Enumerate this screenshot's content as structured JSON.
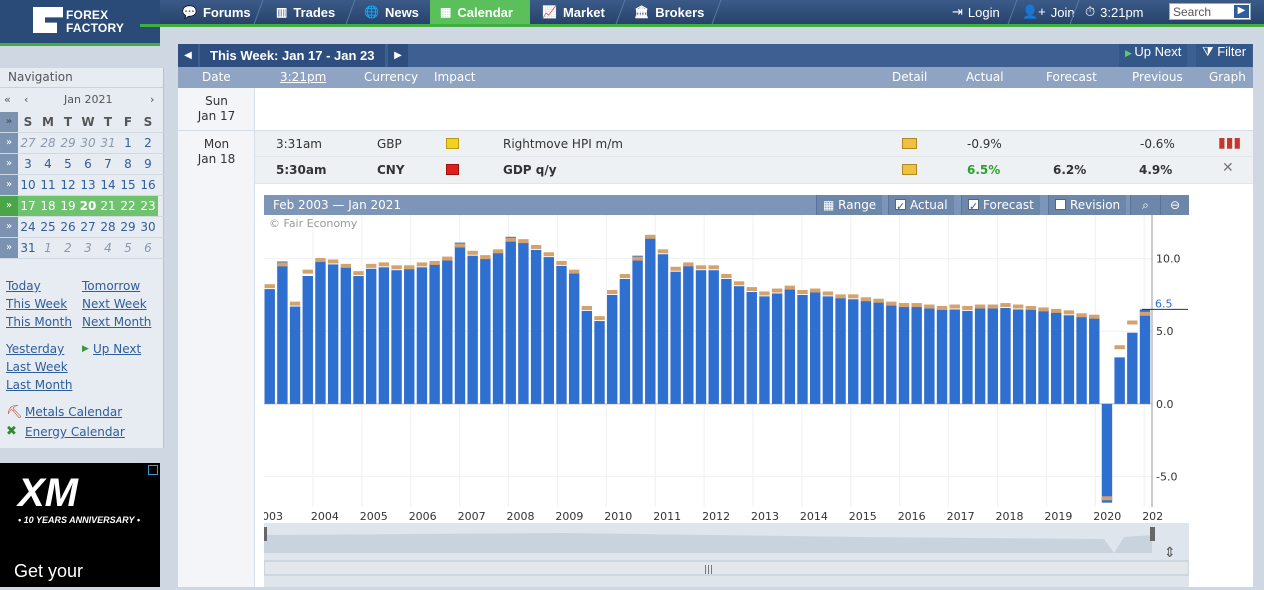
{
  "header": {
    "logo_line1": "FOREX",
    "logo_line2": "FACTORY",
    "nav": [
      {
        "label": "Forums",
        "icon": "chat-icon"
      },
      {
        "label": "Trades",
        "icon": "bars-icon"
      },
      {
        "label": "News",
        "icon": "globe-icon"
      },
      {
        "label": "Calendar",
        "icon": "calendar-icon"
      },
      {
        "label": "Market",
        "icon": "market-chart-icon"
      },
      {
        "label": "Brokers",
        "icon": "brokers-icon"
      }
    ],
    "login": "Login",
    "join": "Join",
    "time": "3:21pm",
    "search_placeholder": "Search"
  },
  "sidebar": {
    "title": "Navigation",
    "month": "Jan 2021",
    "weekdays": [
      "S",
      "M",
      "T",
      "W",
      "T",
      "F",
      "S"
    ],
    "weeks": [
      [
        "27",
        "28",
        "29",
        "30",
        "31",
        "1",
        "2"
      ],
      [
        "3",
        "4",
        "5",
        "6",
        "7",
        "8",
        "9"
      ],
      [
        "10",
        "11",
        "12",
        "13",
        "14",
        "15",
        "16"
      ],
      [
        "17",
        "18",
        "19",
        "20",
        "21",
        "22",
        "23"
      ],
      [
        "24",
        "25",
        "26",
        "27",
        "28",
        "29",
        "30"
      ],
      [
        "31",
        "1",
        "2",
        "3",
        "4",
        "5",
        "6"
      ]
    ],
    "links": {
      "today": "Today",
      "tomorrow": "Tomorrow",
      "this_week": "This Week",
      "next_week": "Next Week",
      "this_month": "This Month",
      "next_month": "Next Month",
      "yesterday": "Yesterday",
      "up_next": "Up Next",
      "last_week": "Last Week",
      "last_month": "Last Month",
      "metals": "Metals Calendar",
      "energy": "Energy Calendar"
    }
  },
  "ad": {
    "brand": "XM",
    "tagline": "• 10 YEARS ANNIVERSARY •",
    "cta": "Get your"
  },
  "calendar": {
    "week_label": "This Week: Jan 17 - Jan 23",
    "up_next": "Up Next",
    "filter": "Filter",
    "columns": {
      "date": "Date",
      "time": "3:21pm",
      "currency": "Currency",
      "impact": "Impact",
      "detail": "Detail",
      "actual": "Actual",
      "forecast": "Forecast",
      "previous": "Previous",
      "graph": "Graph"
    },
    "days": [
      {
        "day": "Sun",
        "date": "Jan 17"
      },
      {
        "day": "Mon",
        "date": "Jan 18"
      }
    ],
    "events": [
      {
        "time": "3:31am",
        "currency": "GBP",
        "impact_color": "#f2d21c",
        "event": "Rightmove HPI m/m",
        "actual": "-0.9%",
        "forecast": "",
        "previous": "-0.6%"
      },
      {
        "time": "5:30am",
        "currency": "CNY",
        "impact_color": "#dd1f1f",
        "event": "GDP q/y",
        "actual": "6.5%",
        "forecast": "6.2%",
        "previous": "4.9%"
      }
    ]
  },
  "chart_panel": {
    "range_title": "Feb 2003 — Jan 2021",
    "range_btn": "Range",
    "actual_label": "Actual",
    "forecast_label": "Forecast",
    "revision_label": "Revision",
    "copyright": "© Fair Economy",
    "last_value_label": "6.5"
  },
  "chart_data": {
    "type": "bar",
    "title": "",
    "ylim": [
      -8.2,
      13.0
    ],
    "yticks": [
      "10.0",
      "5.0",
      "0.0",
      "-5.0"
    ],
    "ytick_values": [
      10,
      5,
      0,
      -5
    ],
    "xticks": [
      "003",
      "2004",
      "2005",
      "2006",
      "2007",
      "2008",
      "2009",
      "2010",
      "2011",
      "2012",
      "2013",
      "2014",
      "2015",
      "2016",
      "2017",
      "2018",
      "2019",
      "2020",
      "202"
    ],
    "series": [
      {
        "name": "Actual",
        "color": "#2f6fd0",
        "values": [
          7.9,
          9.8,
          6.7,
          8.8,
          9.8,
          9.6,
          9.4,
          8.8,
          9.3,
          9.4,
          9.2,
          9.3,
          9.4,
          9.6,
          9.9,
          11.1,
          10.2,
          10.0,
          10.4,
          11.5,
          11.1,
          10.6,
          10.1,
          9.5,
          9.0,
          6.4,
          5.7,
          7.5,
          8.6,
          10.2,
          11.6,
          10.3,
          9.1,
          9.5,
          9.2,
          9.2,
          8.6,
          8.1,
          7.7,
          7.4,
          7.6,
          7.9,
          7.5,
          7.7,
          7.4,
          7.3,
          7.2,
          7.1,
          7.0,
          6.8,
          6.7,
          6.7,
          6.6,
          6.5,
          6.5,
          6.4,
          6.6,
          6.6,
          6.6,
          6.5,
          6.5,
          6.4,
          6.3,
          6.1,
          6.0,
          5.9,
          -6.8,
          3.2,
          4.9,
          6.5
        ]
      },
      {
        "name": "Forecast",
        "color": "#d4a26c",
        "values": [
          8.1,
          9.6,
          6.9,
          9.1,
          9.9,
          9.8,
          9.5,
          9.0,
          9.5,
          9.6,
          9.4,
          9.4,
          9.6,
          9.7,
          10.0,
          10.9,
          10.4,
          10.1,
          10.5,
          11.3,
          11.2,
          10.8,
          10.3,
          9.7,
          9.1,
          6.6,
          5.9,
          7.7,
          8.8,
          10.0,
          11.5,
          10.5,
          9.3,
          9.6,
          9.4,
          9.4,
          8.8,
          8.3,
          7.9,
          7.6,
          7.8,
          8.0,
          7.7,
          7.8,
          7.6,
          7.4,
          7.4,
          7.2,
          7.1,
          6.9,
          6.8,
          6.8,
          6.7,
          6.6,
          6.7,
          6.6,
          6.7,
          6.7,
          6.8,
          6.7,
          6.6,
          6.5,
          6.4,
          6.3,
          6.1,
          6.0,
          -6.5,
          3.9,
          5.6,
          6.2
        ]
      }
    ]
  }
}
